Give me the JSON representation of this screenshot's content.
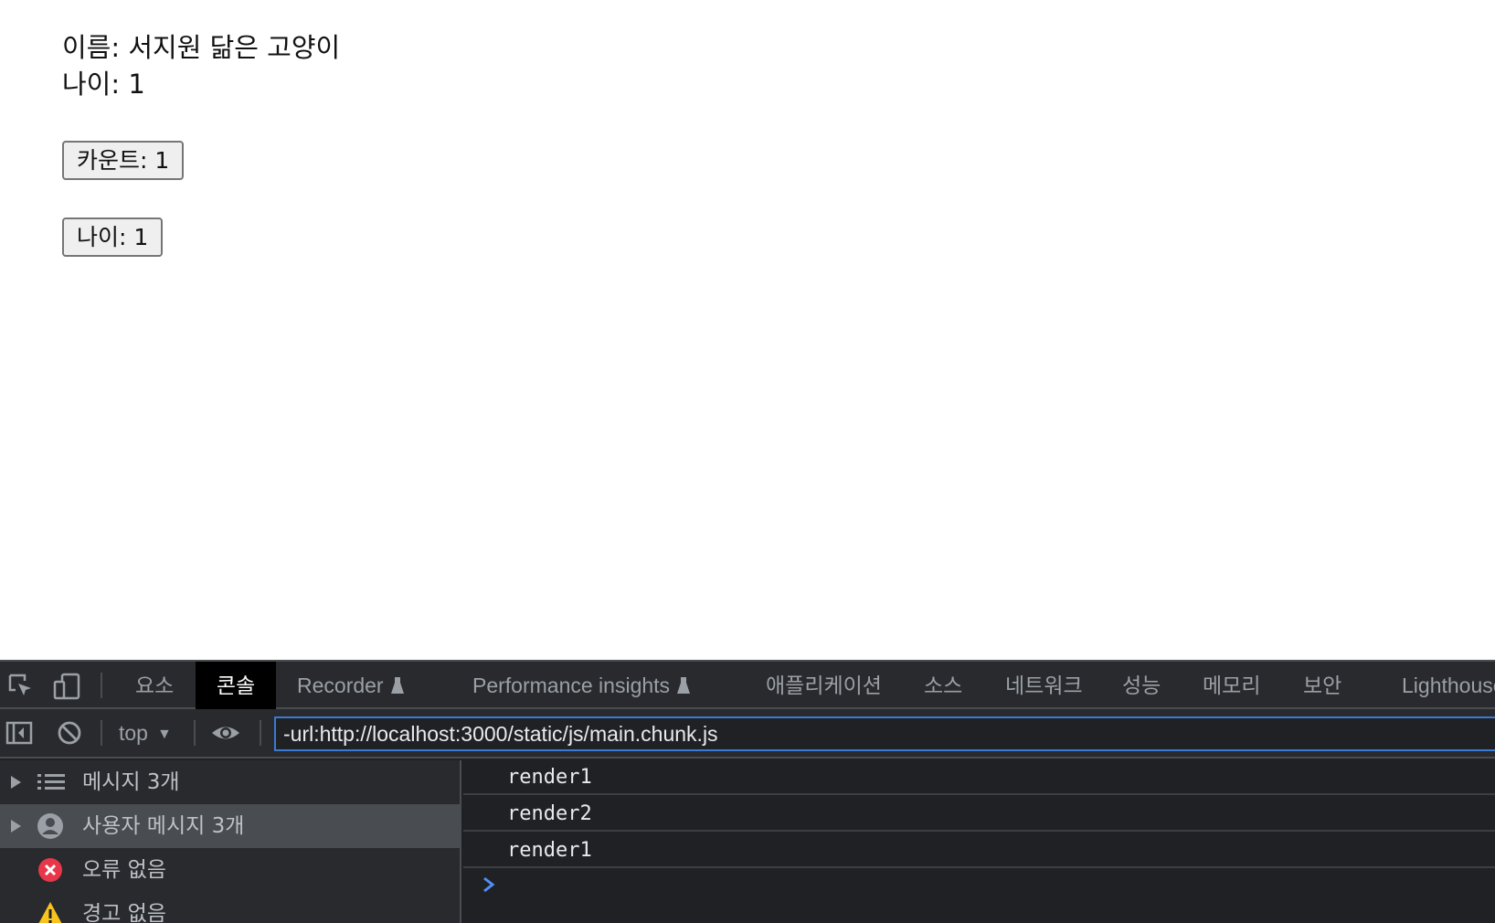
{
  "app": {
    "name_line": "이름: 서지원 닮은 고양이",
    "age_line": "나이: 1",
    "count_button": "카운트: 1",
    "age_button": "나이: 1"
  },
  "devtools": {
    "tabs": [
      "요소",
      "콘솔",
      "Recorder",
      "Performance insights",
      "애플리케이션",
      "소스",
      "네트워크",
      "성능",
      "메모리",
      "보안",
      "Lighthouse"
    ],
    "active_tab": "콘솔",
    "context_select": "top",
    "filter_value": "-url:http://localhost:3000/static/js/main.chunk.js",
    "sidebar": [
      {
        "label": "메시지 3개",
        "icon": "list-icon",
        "expandable": true,
        "selected": false
      },
      {
        "label": "사용자 메시지 3개",
        "icon": "user-icon",
        "expandable": true,
        "selected": true
      },
      {
        "label": "오류 없음",
        "icon": "error-icon",
        "expandable": false,
        "selected": false
      },
      {
        "label": "경고 없음",
        "icon": "warning-icon",
        "expandable": false,
        "selected": false
      }
    ],
    "logs": [
      "render1",
      "render2",
      "render1"
    ]
  },
  "colors": {
    "devtools_bg": "#202124",
    "toolbar_bg": "#292a2d",
    "accent_blue": "#3a7bd5",
    "error_red": "#e8374b",
    "warning_yellow": "#f9c31e"
  }
}
